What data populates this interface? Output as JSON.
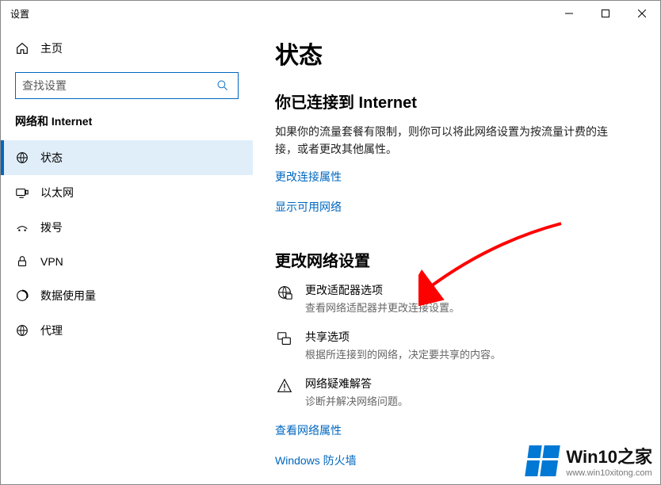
{
  "window": {
    "title": "设置"
  },
  "sidebar": {
    "home": "主页",
    "search_placeholder": "查找设置",
    "section": "网络和 Internet",
    "items": [
      {
        "label": "状态"
      },
      {
        "label": "以太网"
      },
      {
        "label": "拨号"
      },
      {
        "label": "VPN"
      },
      {
        "label": "数据使用量"
      },
      {
        "label": "代理"
      }
    ]
  },
  "content": {
    "title": "状态",
    "connected_heading": "你已连接到 Internet",
    "connected_body": "如果你的流量套餐有限制，则你可以将此网络设置为按流量计费的连接，或者更改其他属性。",
    "link_change_props": "更改连接属性",
    "link_show_networks": "显示可用网络",
    "change_settings_heading": "更改网络设置",
    "options": [
      {
        "title": "更改适配器选项",
        "desc": "查看网络适配器并更改连接设置。"
      },
      {
        "title": "共享选项",
        "desc": "根据所连接到的网络，决定要共享的内容。"
      },
      {
        "title": "网络疑难解答",
        "desc": "诊断并解决网络问题。"
      }
    ],
    "link_view_props": "查看网络属性",
    "link_firewall": "Windows 防火墙"
  },
  "watermark": {
    "line1": "Win10之家",
    "line2": "www.win10xitong.com"
  },
  "colors": {
    "accent": "#0067c0",
    "arrow": "#ff0000"
  }
}
